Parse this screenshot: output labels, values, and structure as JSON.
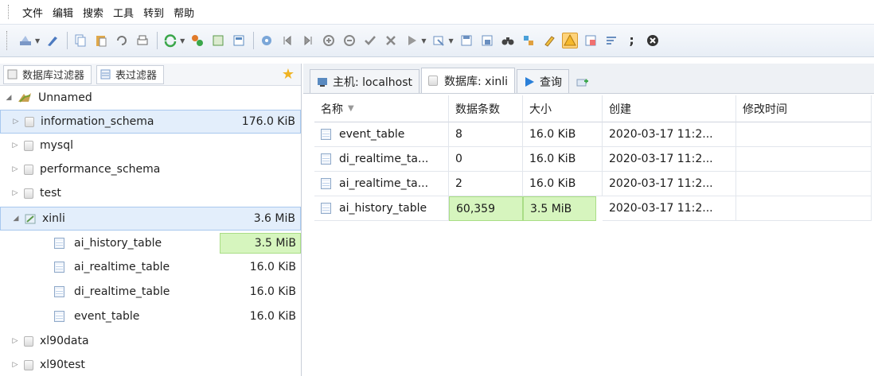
{
  "menu": [
    "文件",
    "编辑",
    "搜索",
    "工具",
    "转到",
    "帮助"
  ],
  "toolbar": {
    "icons": [
      "wizard-icon",
      "brush-icon",
      "copy-icon",
      "paste-icon",
      "undo-icon",
      "print-icon",
      "refresh-icon",
      "connect-icon",
      "table-icon",
      "query-icon",
      "stop-icon",
      "first-icon",
      "last-icon",
      "add-icon",
      "remove-icon",
      "check-icon",
      "cancel-icon",
      "play-icon",
      "import-icon",
      "save-icon",
      "save-as-icon",
      "binoculars-icon",
      "tags-icon",
      "edit-icon",
      "warning-icon",
      "hex-icon",
      "wrap-icon",
      "semicolon-icon",
      "close-circle-icon"
    ]
  },
  "left": {
    "tabs": [
      {
        "label": "数据库过滤器"
      },
      {
        "label": "表过滤器"
      }
    ],
    "tree": [
      {
        "label": "Unnamed",
        "size": "",
        "level": 0,
        "type": "root"
      },
      {
        "label": "information_schema",
        "size": "176.0 KiB",
        "level": 1,
        "type": "db"
      },
      {
        "label": "mysql",
        "size": "",
        "level": 1,
        "type": "db"
      },
      {
        "label": "performance_schema",
        "size": "",
        "level": 1,
        "type": "db"
      },
      {
        "label": "test",
        "size": "",
        "level": 1,
        "type": "db"
      },
      {
        "label": "xinli",
        "size": "3.6 MiB",
        "level": 1,
        "type": "db-open"
      },
      {
        "label": "ai_history_table",
        "size": "3.5 MiB",
        "level": 2,
        "type": "table"
      },
      {
        "label": "ai_realtime_table",
        "size": "16.0 KiB",
        "level": 2,
        "type": "table"
      },
      {
        "label": "di_realtime_table",
        "size": "16.0 KiB",
        "level": 2,
        "type": "table"
      },
      {
        "label": "event_table",
        "size": "16.0 KiB",
        "level": 2,
        "type": "table"
      },
      {
        "label": "xl90data",
        "size": "",
        "level": 1,
        "type": "db"
      },
      {
        "label": "xl90test",
        "size": "",
        "level": 1,
        "type": "db"
      }
    ]
  },
  "right": {
    "tabs": [
      {
        "label": "主机: localhost"
      },
      {
        "label": "数据库: xinli"
      },
      {
        "label": "查询"
      }
    ],
    "columns": [
      "名称",
      "数据条数",
      "大小",
      "创建",
      "修改时间"
    ],
    "rows": [
      [
        "event_table",
        "8",
        "16.0 KiB",
        "2020-03-17 11:2...",
        ""
      ],
      [
        "di_realtime_ta...",
        "0",
        "16.0 KiB",
        "2020-03-17 11:2...",
        ""
      ],
      [
        "ai_realtime_ta...",
        "2",
        "16.0 KiB",
        "2020-03-17 11:2...",
        ""
      ],
      [
        "ai_history_table",
        "60,359",
        "3.5 MiB",
        "2020-03-17 11:2...",
        ""
      ]
    ]
  }
}
